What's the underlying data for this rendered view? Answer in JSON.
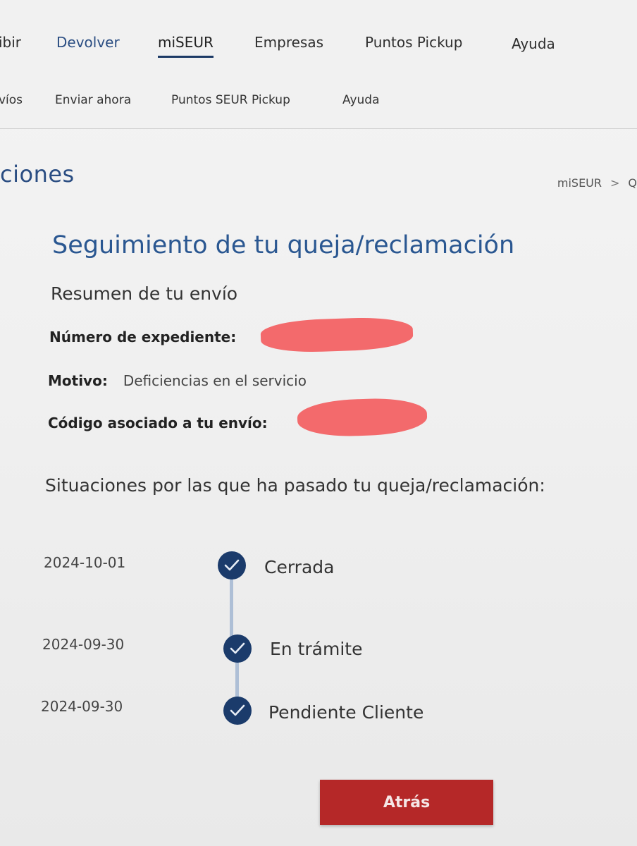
{
  "top_nav": {
    "items": [
      {
        "label": "ibir"
      },
      {
        "label": "Devolver"
      },
      {
        "label": "miSEUR"
      },
      {
        "label": "Empresas"
      },
      {
        "label": "Puntos Pickup"
      },
      {
        "label": "Ayuda"
      }
    ],
    "active": "miSEUR"
  },
  "sub_nav": {
    "items": [
      {
        "label": "víos"
      },
      {
        "label": "Enviar ahora"
      },
      {
        "label": "Puntos SEUR Pickup"
      },
      {
        "label": "Ayuda"
      }
    ]
  },
  "header": {
    "section_title": "ciones",
    "breadcrumb": [
      "miSEUR",
      "Q"
    ]
  },
  "main": {
    "title": "Seguimiento de tu queja/reclamación",
    "summary_title": "Resumen de tu envío",
    "fields": {
      "expediente_label": "Número de expediente:",
      "motivo_label": "Motivo:",
      "motivo_value": "Deficiencias en el servicio",
      "codigo_label": "Código asociado a tu envío:"
    },
    "situations_title": "Situaciones por las que ha pasado tu queja/reclamación:",
    "timeline": [
      {
        "date": "2024-10-01",
        "status": "Cerrada"
      },
      {
        "date": "2024-09-30",
        "status": "En trámite"
      },
      {
        "date": "2024-09-30",
        "status": "Pendiente Cliente"
      }
    ],
    "back_button": "Atrás"
  },
  "colors": {
    "brand_blue": "#2a5791",
    "check_navy": "#1b3b6b",
    "button_red": "#b52828",
    "redaction": "#f26264"
  }
}
